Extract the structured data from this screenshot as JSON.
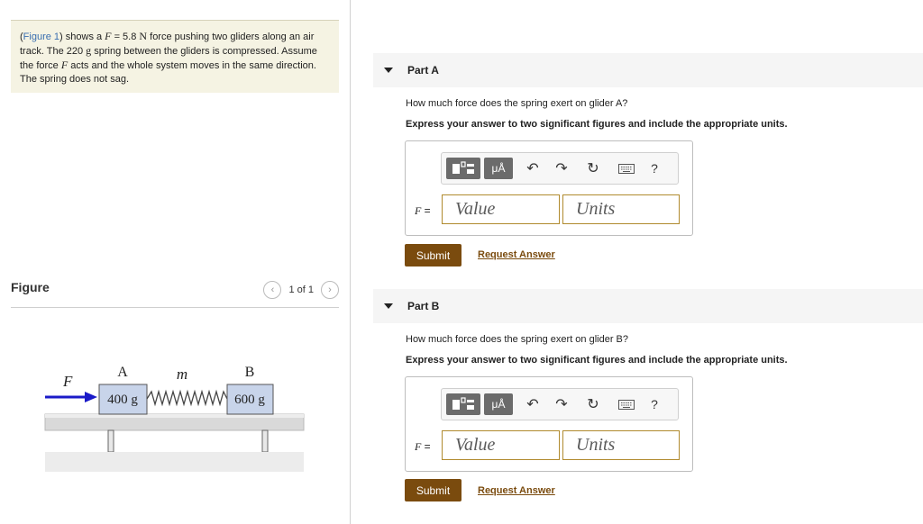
{
  "problem": {
    "figure_link": "Figure 1",
    "text_a": " shows a ",
    "var_f": "F",
    "text_b": " = 5.8 ",
    "unit_n": "N",
    "text_c": " force pushing two gliders along an air track. The 220 ",
    "unit_g": "g",
    "text_d": " spring between the gliders is compressed. Assume the force ",
    "var_f2": "F",
    "text_e": " acts and the whole system moves in the same direction. The spring does not sag."
  },
  "figure": {
    "title": "Figure",
    "pager": "1 of 1",
    "prev_icon": "chevron-left-icon",
    "next_icon": "chevron-right-icon",
    "label_force": "F",
    "label_a": "A",
    "label_spring": "m",
    "label_b": "B",
    "mass_a": "400 g",
    "mass_b": "600 g"
  },
  "toolbar": {
    "icons": [
      "templates-icon",
      "units-mu-angstrom-icon",
      "undo-icon",
      "redo-icon",
      "reset-icon",
      "keyboard-icon",
      "help-icon"
    ],
    "mu_a_label": "μÅ",
    "help_label": "?"
  },
  "parts": [
    {
      "label": "Part A",
      "question": "How much force does the spring exert on glider A?",
      "instruction": "Express your answer to two significant figures and include the appropriate units.",
      "eq_var": "F",
      "eq_sign": " =",
      "value_placeholder": "Value",
      "units_placeholder": "Units",
      "submit": "Submit",
      "request": "Request Answer"
    },
    {
      "label": "Part B",
      "question": "How much force does the spring exert on glider B?",
      "instruction": "Express your answer to two significant figures and include the appropriate units.",
      "eq_var": "F",
      "eq_sign": " =",
      "value_placeholder": "Value",
      "units_placeholder": "Units",
      "submit": "Submit",
      "request": "Request Answer"
    }
  ],
  "colors": {
    "accent_brown": "#7a4b0e",
    "field_border": "#b08a2e",
    "problem_bg": "#f5f3e3",
    "arrow_blue": "#1a1ac8",
    "glider_fill": "#c8d4ea"
  }
}
